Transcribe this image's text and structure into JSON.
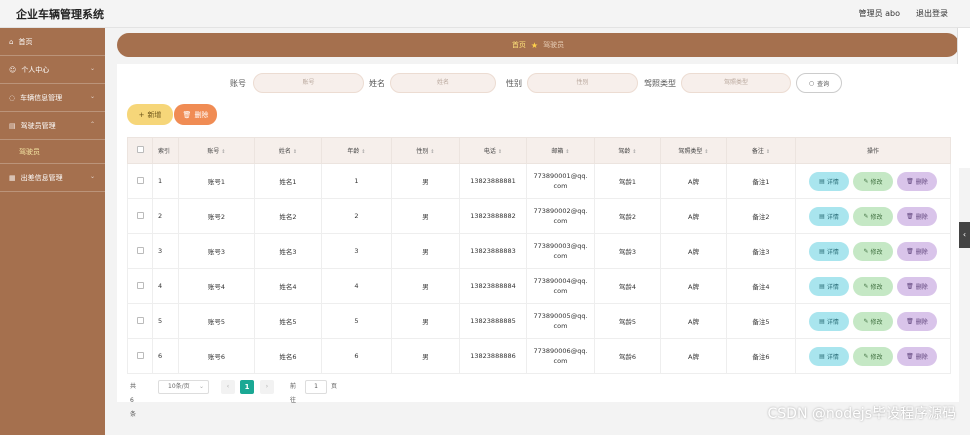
{
  "app": {
    "title": "企业车辆管理系统",
    "admin": "管理员 abo",
    "logout": "退出登录"
  },
  "sidebar": {
    "items": [
      {
        "label": "首页",
        "icon": "home-icon"
      },
      {
        "label": "个人中心",
        "icon": "user-icon"
      },
      {
        "label": "车辆信息管理",
        "icon": "car-icon"
      },
      {
        "label": "驾驶员管理",
        "icon": "driver-icon"
      },
      {
        "label": "出差信息管理",
        "icon": "trip-icon"
      }
    ],
    "sub": "驾驶员"
  },
  "breadcrumb": {
    "home": "首页",
    "current": "驾驶员"
  },
  "search": {
    "fields": [
      {
        "label": "账号",
        "placeholder": "账号"
      },
      {
        "label": "姓名",
        "placeholder": "姓名"
      },
      {
        "label": "性别",
        "placeholder": "性别"
      },
      {
        "label": "驾照类型",
        "placeholder": "驾照类型"
      }
    ],
    "query_label": "查询"
  },
  "toolbar": {
    "add_label": "新增",
    "delete_label": "删除"
  },
  "table": {
    "headers": [
      "索引",
      "账号",
      "姓名",
      "年龄",
      "性别",
      "电话",
      "邮箱",
      "驾龄",
      "驾照类型",
      "备注",
      "操作"
    ],
    "rows": [
      [
        "1",
        "账号1",
        "姓名1",
        "1",
        "男",
        "13823888881",
        "773890001@qq.\ncom",
        "驾龄1",
        "A牌",
        "备注1"
      ],
      [
        "2",
        "账号2",
        "姓名2",
        "2",
        "男",
        "13823888882",
        "773890002@qq.\ncom",
        "驾龄2",
        "A牌",
        "备注2"
      ],
      [
        "3",
        "账号3",
        "姓名3",
        "3",
        "男",
        "13823888883",
        "773890003@qq.\ncom",
        "驾龄3",
        "A牌",
        "备注3"
      ],
      [
        "4",
        "账号4",
        "姓名4",
        "4",
        "男",
        "13823888884",
        "773890004@qq.\ncom",
        "驾龄4",
        "A牌",
        "备注4"
      ],
      [
        "5",
        "账号5",
        "姓名5",
        "5",
        "男",
        "13823888885",
        "773890005@qq.\ncom",
        "驾龄5",
        "A牌",
        "备注5"
      ],
      [
        "6",
        "账号6",
        "姓名6",
        "6",
        "男",
        "13823888886",
        "773890006@qq.\ncom",
        "驾龄6",
        "A牌",
        "备注6"
      ]
    ],
    "ops": {
      "detail": "详情",
      "edit": "修改",
      "delete": "删除"
    }
  },
  "pager": {
    "total": "共 6 条",
    "page_size": "10条/页",
    "current": "1",
    "goto_label": "前往",
    "goto_value": "1",
    "page_unit": "页"
  },
  "watermark": "CSDN @nodejs毕设程序源码"
}
